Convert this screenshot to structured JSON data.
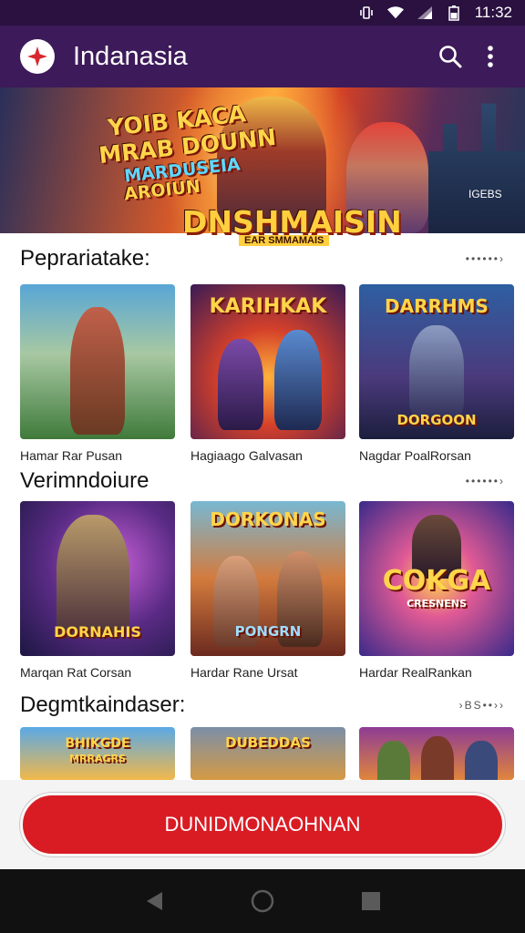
{
  "status_bar": {
    "time": "11:32",
    "icons": [
      "vibrate-icon",
      "wifi-icon",
      "signal-icon",
      "battery-icon"
    ]
  },
  "app_bar": {
    "title": "Indanasia",
    "actions": [
      "search-icon",
      "more-vert-icon"
    ]
  },
  "hero": {
    "headline_lines": [
      "YOIB KACA",
      "MRAB DOUNN",
      "MARDUSEIA",
      "AROIUN"
    ],
    "brand": "DNSHMAISIN",
    "brand_sub": "EAR SMMAMAIS",
    "corner_tag": "IGEBS"
  },
  "sections": [
    {
      "title": "Peprariatake:",
      "more": "••••••›",
      "cards": [
        {
          "art_title": "",
          "label": "Hamar Rar Pusan"
        },
        {
          "art_title": "KARIHKAK",
          "label": "Hagiaago Galvasan"
        },
        {
          "art_title": "DARRHMS",
          "art_subtitle": "DORGOON",
          "label": "Nagdar PoalRorsan"
        }
      ]
    },
    {
      "title": "Verimndoiure",
      "more": "••••••›",
      "cards": [
        {
          "art_title": "DORNAHIS",
          "label": "Marqan Rat Corsan"
        },
        {
          "art_title": "DORKONAS",
          "art_subtitle": "PONGRN",
          "label": "Hardar Rane Ursat"
        },
        {
          "art_title": "COKGA",
          "art_subtitle": "CRESNENS",
          "label": "Hardar RealRankan"
        }
      ]
    },
    {
      "title": "Degmtkaindaser:",
      "more": "›BS••››",
      "cards": [
        {
          "art_title": "BHIKGDE",
          "art_subtitle": "MRRAGRS"
        },
        {
          "art_title": "DUBEDDAS"
        },
        {
          "art_title": ""
        }
      ]
    }
  ],
  "cta": {
    "label": "DUNIDMONAOHNAN"
  },
  "nav": [
    "back-icon",
    "home-icon",
    "recents-icon"
  ]
}
